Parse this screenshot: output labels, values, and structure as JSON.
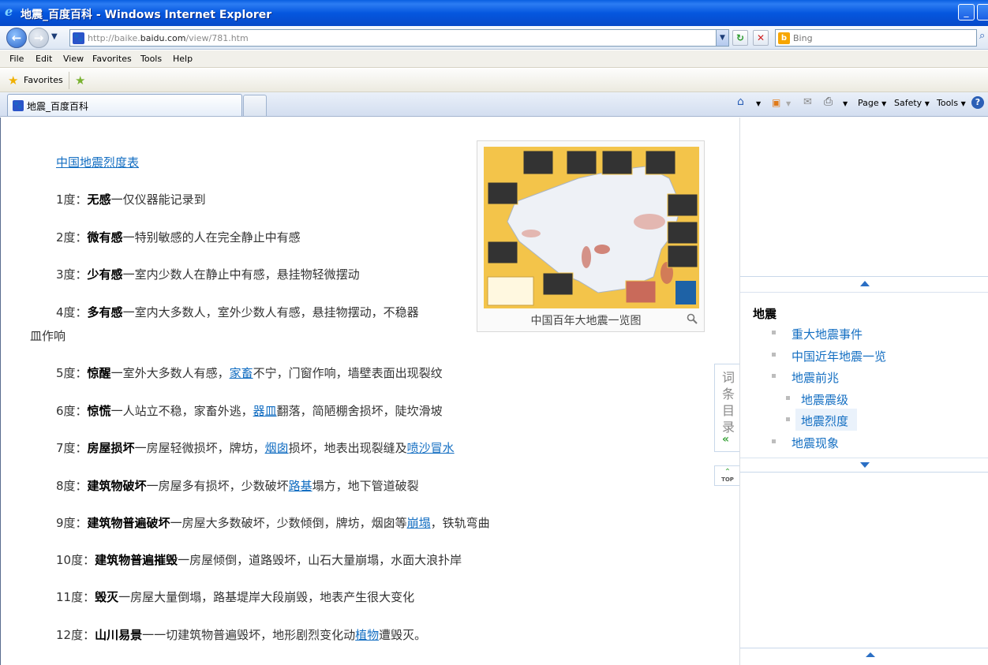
{
  "window": {
    "title": "地震_百度百科 - Windows Internet Explorer"
  },
  "nav": {
    "url_prefix": "http://baike.",
    "url_domain": "baidu.com",
    "url_path": "/view/781.htm",
    "search_placeholder": "Bing"
  },
  "menu": [
    "File",
    "Edit",
    "View",
    "Favorites",
    "Tools",
    "Help"
  ],
  "favorites": {
    "label": "Favorites"
  },
  "tab": {
    "title": "地震_百度百科"
  },
  "commandbar": {
    "page": "Page",
    "safety": "Safety",
    "tools": "Tools"
  },
  "article": {
    "heading_link": "中国地震烈度表",
    "figure_caption": "中国百年大地震一览图",
    "lines": [
      {
        "prefix": "1度：",
        "bold": "无感",
        "text": "一仅仪器能记录到"
      },
      {
        "prefix": "2度：",
        "bold": "微有感",
        "text": "一特别敏感的人在完全静止中有感"
      },
      {
        "prefix": "3度：",
        "bold": "少有感",
        "text": "一室内少数人在静止中有感，悬挂物轻微摆动"
      },
      {
        "prefix": "4度：",
        "bold": "多有感",
        "text": "一室内大多数人，室外少数人有感，悬挂物摆动，不稳器",
        "cont": "皿作响"
      },
      {
        "prefix": "5度：",
        "bold": "惊醒",
        "text_a": "一室外大多数人有感，",
        "link": "家畜",
        "text_b": "不宁，门窗作响，墙壁表面出现裂纹"
      },
      {
        "prefix": "6度：",
        "bold": "惊慌",
        "text_a": "一人站立不稳，家畜外逃，",
        "link": "器皿",
        "text_b": "翻落，简陋棚舍损坏，陡坎滑坡"
      },
      {
        "prefix": "7度：",
        "bold": "房屋损坏",
        "text_a": "一房屋轻微损坏，牌坊，",
        "link": "烟囱",
        "text_b": "损坏，地表出现裂缝及",
        "link2": "喷沙冒水"
      },
      {
        "prefix": "8度：",
        "bold": "建筑物破坏",
        "text_a": "一房屋多有损坏，少数破坏",
        "link": "路基",
        "text_b": "塌方，地下管道破裂"
      },
      {
        "prefix": "9度：",
        "bold": "建筑物普遍破坏",
        "text_a": "一房屋大多数破坏，少数倾倒，牌坊，烟囱等",
        "link": "崩塌",
        "text_b": "，铁轨弯曲"
      },
      {
        "prefix": "10度：",
        "bold": "建筑物普遍摧毁",
        "text": "一房屋倾倒，道路毁坏，山石大量崩塌，水面大浪扑岸"
      },
      {
        "prefix": "11度：",
        "bold": "毁灭",
        "text": "一房屋大量倒塌，路基堤岸大段崩毁，地表产生很大变化"
      },
      {
        "prefix": "12度：",
        "bold": "山川易景",
        "text_a": "一一切建筑物普遍毁坏，地形剧烈变化动",
        "link": "植物",
        "text_b": "遭毁灭。"
      }
    ]
  },
  "toc": {
    "tab_label": "词条目录",
    "top_label": "TOP",
    "title": "地震",
    "items": [
      {
        "label": "重大地震事件",
        "level": 1
      },
      {
        "label": "中国近年地震一览",
        "level": 1
      },
      {
        "label": "地震前兆",
        "level": 1
      },
      {
        "label": "地震震级",
        "level": 2
      },
      {
        "label": "地震烈度",
        "level": 2
      },
      {
        "label": "地震现象",
        "level": 1
      }
    ]
  }
}
